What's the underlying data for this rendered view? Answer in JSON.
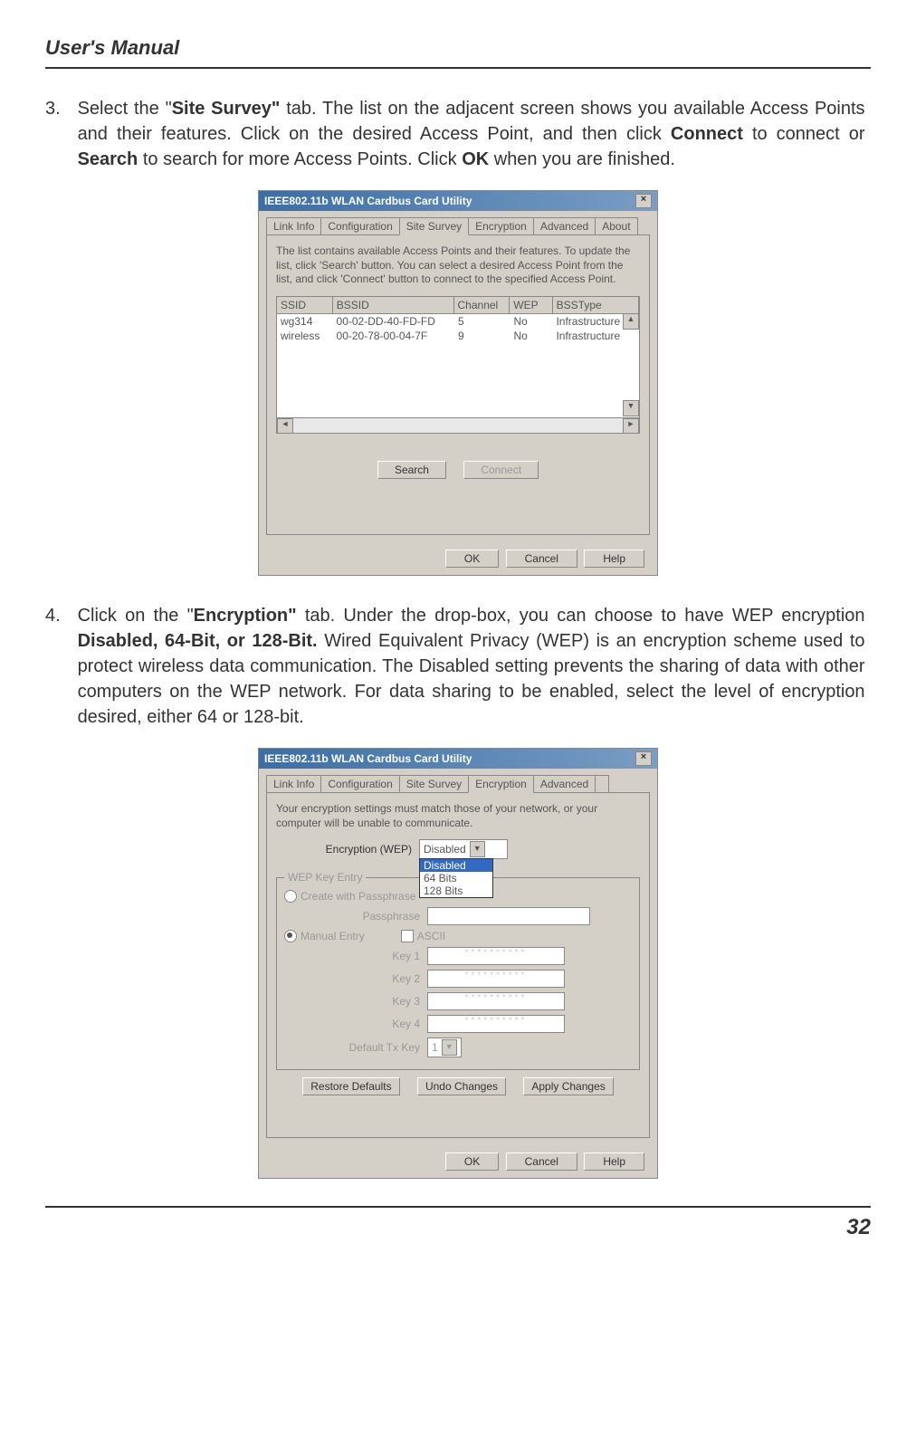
{
  "header": "User's Manual",
  "pageNumber": "32",
  "step3": {
    "num": "3.",
    "prefix": "Select the \"",
    "bold1": "Site Survey\"",
    "mid1": " tab. The list on the adjacent screen shows you available Access Points and their features. Click on the desired Access Point, and then click ",
    "bold2": "Connect",
    "mid2": " to connect or ",
    "bold3": "Search",
    "mid3": " to search for more Access Points. Click ",
    "bold4": "OK",
    "end": " when you are finished."
  },
  "step4": {
    "num": "4.",
    "prefix": "Click on the \"",
    "bold1": "Encryption\"",
    "mid1": " tab. Under the drop-box, you can choose to have WEP encryption ",
    "bold2": "Disabled, 64-Bit, or 128-Bit.",
    "end": " Wired Equivalent Privacy (WEP) is an encryption scheme used to protect wireless data communication. The Disabled setting prevents the sharing of data with other computers on the WEP network. For data sharing to be enabled, select the level of encryption desired, either 64 or 128-bit."
  },
  "dialog": {
    "title": "IEEE802.11b WLAN Cardbus Card Utility",
    "tabs": {
      "linkinfo": "Link Info",
      "config": "Configuration",
      "sitesurvey": "Site Survey",
      "encryption": "Encryption",
      "advanced": "Advanced",
      "about": "About"
    },
    "sitesurvey": {
      "desc": "The list contains available Access Points and their features. To update the list, click 'Search' button. You can select a desired Access Point from the list, and click 'Connect' button to connect to the specified Access Point.",
      "headers": {
        "ssid": "SSID",
        "bssid": "BSSID",
        "channel": "Channel",
        "wep": "WEP",
        "bsstype": "BSSType"
      },
      "rows": [
        {
          "ssid": "wg314",
          "bssid": "00-02-DD-40-FD-FD",
          "channel": "5",
          "wep": "No",
          "bsstype": "Infrastructure"
        },
        {
          "ssid": "wireless",
          "bssid": "00-20-78-00-04-7F",
          "channel": "9",
          "wep": "No",
          "bsstype": "Infrastructure"
        }
      ],
      "searchBtn": "Search",
      "connectBtn": "Connect"
    },
    "encryption": {
      "desc": "Your encryption settings must match those of your network, or your computer will be unable to communicate.",
      "wepLabel": "Encryption (WEP)",
      "wepValue": "Disabled",
      "options": [
        "Disabled",
        "64 Bits",
        "128 Bits"
      ],
      "keyEntryLegend": "WEP Key Entry",
      "createPassphrase": "Create with Passphrase",
      "passphraseLabel": "Passphrase",
      "manualEntry": "Manual Entry",
      "asciiLabel": "ASCII",
      "key1": "Key 1",
      "key2": "Key 2",
      "key3": "Key 3",
      "key4": "Key 4",
      "defaultTxKey": "Default Tx Key",
      "defaultTxValue": "1",
      "restoreBtn": "Restore Defaults",
      "undoBtn": "Undo Changes",
      "applyBtn": "Apply Changes"
    },
    "okBtn": "OK",
    "cancelBtn": "Cancel",
    "helpBtn": "Help"
  }
}
